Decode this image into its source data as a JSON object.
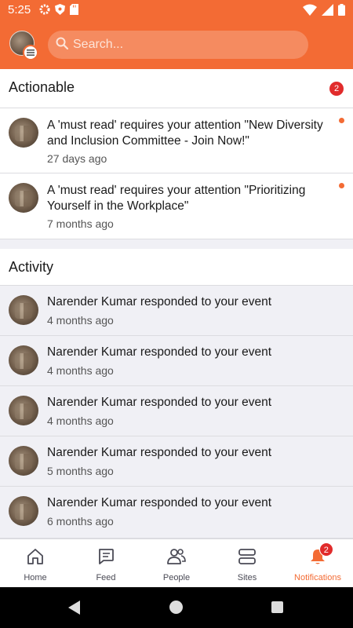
{
  "status_bar": {
    "time": "5:25"
  },
  "header": {
    "search_placeholder": "Search..."
  },
  "actionable": {
    "title": "Actionable",
    "count": "2",
    "items": [
      {
        "text": "A 'must read' requires your attention \"New Diversity and Inclusion Committee - Join Now!\"",
        "time": "27 days ago"
      },
      {
        "text": "A 'must read' requires your attention \"Prioritizing Yourself in the Workplace\"",
        "time": "7 months ago"
      }
    ]
  },
  "activity": {
    "title": "Activity",
    "items": [
      {
        "text": "Narender Kumar responded to your event",
        "time": "4 months ago"
      },
      {
        "text": "Narender Kumar responded to your event",
        "time": "4 months ago"
      },
      {
        "text": "Narender Kumar responded to your event",
        "time": "4 months ago"
      },
      {
        "text": "Narender Kumar responded to your event",
        "time": "5 months ago"
      },
      {
        "text": "Narender Kumar responded to your event",
        "time": "6 months ago"
      }
    ]
  },
  "bottom_nav": {
    "items": [
      {
        "label": "Home",
        "icon": "home-icon"
      },
      {
        "label": "Feed",
        "icon": "feed-icon"
      },
      {
        "label": "People",
        "icon": "people-icon"
      },
      {
        "label": "Sites",
        "icon": "sites-icon"
      },
      {
        "label": "Notifications",
        "icon": "bell-icon",
        "active": true,
        "badge": "2"
      }
    ]
  },
  "colors": {
    "accent": "#f36b34",
    "badge": "#e12b2b"
  }
}
